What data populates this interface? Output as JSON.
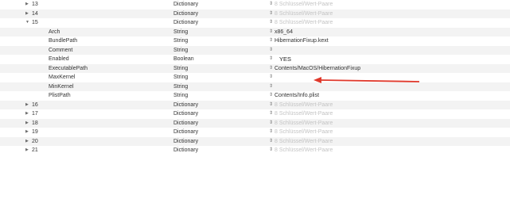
{
  "rows": [
    {
      "key": "13",
      "type": "Dictionary",
      "value": "8 Schlüssel/Wert-Paare",
      "level": 0,
      "disclosure": "collapsed"
    },
    {
      "key": "14",
      "type": "Dictionary",
      "value": "8 Schlüssel/Wert-Paare",
      "level": 0,
      "disclosure": "collapsed"
    },
    {
      "key": "15",
      "type": "Dictionary",
      "value": "8 Schlüssel/Wert-Paare",
      "level": 0,
      "disclosure": "expanded"
    },
    {
      "key": "Arch",
      "type": "String",
      "value": "x86_64",
      "level": 1
    },
    {
      "key": "BundlePath",
      "type": "String",
      "value": "HibernationFixup.kext",
      "level": 1
    },
    {
      "key": "Comment",
      "type": "String",
      "value": "",
      "level": 1
    },
    {
      "key": "Enabled",
      "type": "Boolean",
      "value": "YES",
      "level": 1
    },
    {
      "key": "ExecutablePath",
      "type": "String",
      "value": "Contents/MacOS/HibernationFixup",
      "level": 1
    },
    {
      "key": "MaxKernel",
      "type": "String",
      "value": "",
      "level": 1
    },
    {
      "key": "MinKernel",
      "type": "String",
      "value": "",
      "level": 1
    },
    {
      "key": "PlistPath",
      "type": "String",
      "value": "Contents/Info.plist",
      "level": 1
    },
    {
      "key": "16",
      "type": "Dictionary",
      "value": "8 Schlüssel/Wert-Paare",
      "level": 0,
      "disclosure": "collapsed"
    },
    {
      "key": "17",
      "type": "Dictionary",
      "value": "8 Schlüssel/Wert-Paare",
      "level": 0,
      "disclosure": "collapsed"
    },
    {
      "key": "18",
      "type": "Dictionary",
      "value": "8 Schlüssel/Wert-Paare",
      "level": 0,
      "disclosure": "collapsed"
    },
    {
      "key": "19",
      "type": "Dictionary",
      "value": "8 Schlüssel/Wert-Paare",
      "level": 0,
      "disclosure": "collapsed"
    },
    {
      "key": "20",
      "type": "Dictionary",
      "value": "8 Schlüssel/Wert-Paare",
      "level": 0,
      "disclosure": "collapsed"
    },
    {
      "key": "21",
      "type": "Dictionary",
      "value": "8 Schlüssel/Wert-Paare",
      "level": 0,
      "disclosure": "collapsed"
    }
  ],
  "icons": {
    "collapsed": "disclosure-triangle-right-icon",
    "expanded": "disclosure-triangle-down-icon",
    "stepper": "up-down-stepper-icon",
    "annotation": "red-arrow-icon"
  },
  "colors": {
    "annotation_arrow": "#e0392c",
    "row_alt": "#f3f3f3",
    "dim_value": "#c4c4c4"
  }
}
